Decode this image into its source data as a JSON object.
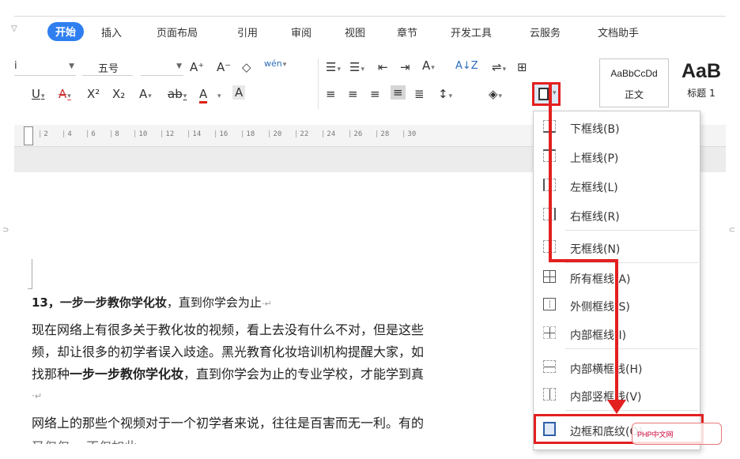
{
  "tabs": [
    {
      "label": "开始",
      "active": true
    },
    {
      "label": "插入"
    },
    {
      "label": "页面布局"
    },
    {
      "label": "引用"
    },
    {
      "label": "审阅"
    },
    {
      "label": "视图"
    },
    {
      "label": "章节"
    },
    {
      "label": "开发工具"
    },
    {
      "label": "云服务"
    },
    {
      "label": "文档助手"
    }
  ],
  "ribbon": {
    "font_name_partial": "i",
    "font_size": "五号",
    "grow_font": "A⁺",
    "shrink_font": "A⁻",
    "phonetic": "wén",
    "underline": "U",
    "strike": "A",
    "superscript": "X²",
    "subscript": "X₂",
    "text_effect": "A",
    "highlight": "ab",
    "font_color": "A",
    "char_shade": "A",
    "sort": "A↓Z",
    "change_case": "A",
    "styles": [
      {
        "sample": "AaBbCcDd",
        "name": "正文"
      },
      {
        "sample": "AaB",
        "name": "标题 1"
      }
    ]
  },
  "ruler": {
    "ticks": [
      "2",
      "4",
      "6",
      "8",
      "10",
      "12",
      "14",
      "16",
      "18",
      "20",
      "22",
      "24",
      "26",
      "28",
      "30"
    ]
  },
  "document": {
    "heading": "13，一步一步教你学化妆，直到你学会为止",
    "heading_bold": "13，一步一步教你学化妆",
    "heading_rest": "，直到你学会为止",
    "line1": "现在网络上有很多关于教化妆的视频，看上去没有什么不对，但是这些",
    "line2": "频，却让很多的初学者误入歧途。黑光教育化妆培训机构提醒大家，如",
    "line3_a": "找那种",
    "line3_b": "一步一步教你学化妆",
    "line3_c": "，直到你学会为止的专业学校，才能学到真",
    "line4": "·",
    "line5": "网络上的那些个视频对于一个初学者来说，往往是百害而无一利。有的",
    "line6": "又仅仅… 不仅如此 …"
  },
  "border_menu": {
    "items": [
      {
        "label": "下框线(B)",
        "icon": "bottom-border-icon"
      },
      {
        "label": "上框线(P)",
        "icon": "top-border-icon"
      },
      {
        "label": "左框线(L)",
        "icon": "left-border-icon"
      },
      {
        "label": "右框线(R)",
        "icon": "right-border-icon"
      },
      {
        "label": "无框线(N)",
        "icon": "no-border-icon"
      },
      {
        "label": "所有框线(A)",
        "icon": "all-borders-icon"
      },
      {
        "label": "外侧框线(S)",
        "icon": "outside-borders-icon"
      },
      {
        "label": "内部框线(I)",
        "icon": "inside-borders-icon"
      },
      {
        "label": "内部横框线(H)",
        "icon": "inside-horizontal-border-icon"
      },
      {
        "label": "内部竖框线(V)",
        "icon": "inside-vertical-border-icon"
      },
      {
        "label": "边框和底纹(O)...",
        "icon": "borders-and-shading-icon"
      }
    ]
  },
  "watermark": {
    "text": "PHP中文网"
  },
  "colors": {
    "accent": "#2f7ff0",
    "annotation_red": "#e32020"
  }
}
